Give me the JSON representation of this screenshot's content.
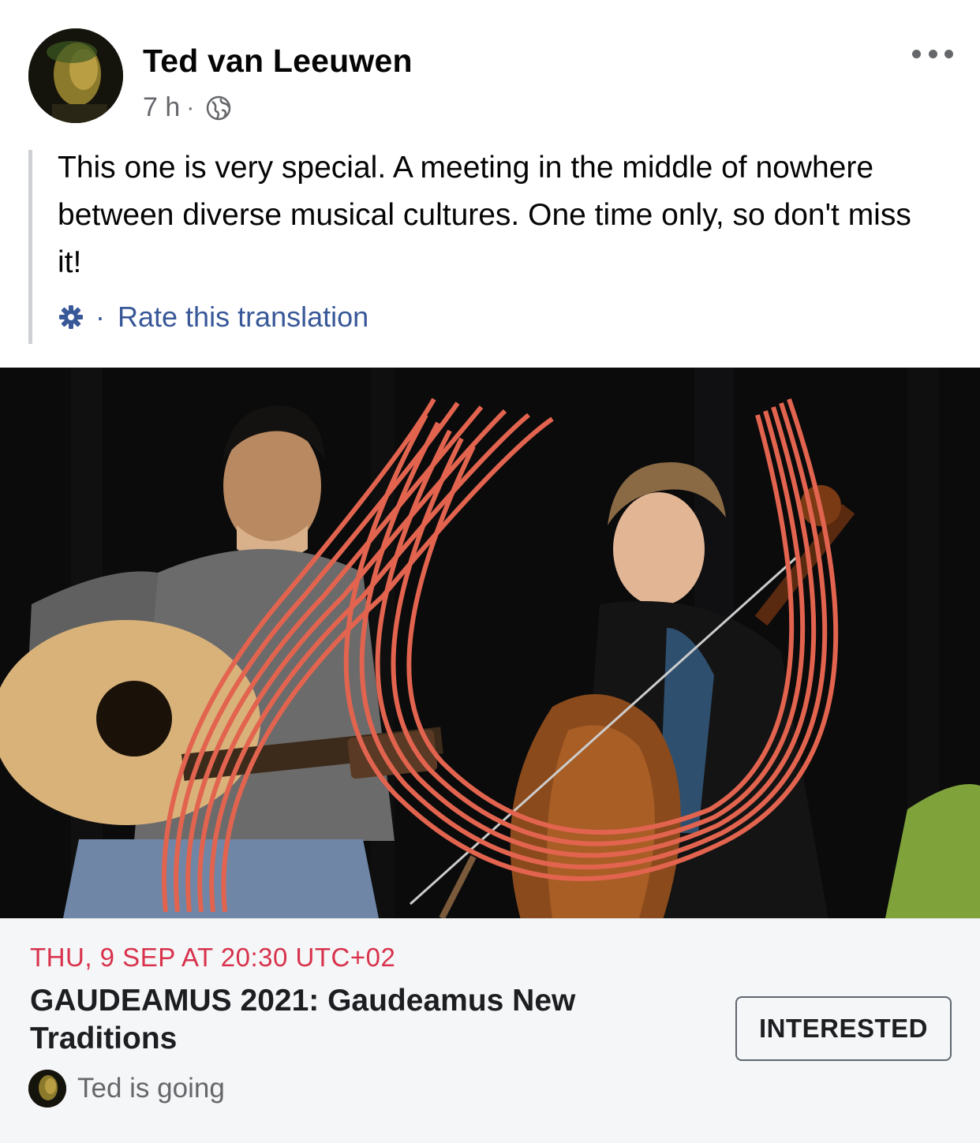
{
  "post": {
    "author": "Ted van Leeuwen",
    "time": "7 h",
    "separator": "·",
    "audience_icon": "globe-icon",
    "menu_icon": "more-horizontal-icon",
    "text": "This one is very special. A meeting in the middle of nowhere between diverse musical cultures. One time only, so don't miss it!",
    "translation": {
      "settings_icon": "gear-icon",
      "separator": "·",
      "rate_label": "Rate this translation"
    }
  },
  "event": {
    "date": "THU, 9 SEP AT 20:30 UTC+02",
    "title": "GAUDEAMUS 2021: Gaudeamus New Traditions",
    "interested_label": "INTERESTED",
    "going_text": "Ted is going"
  },
  "colors": {
    "link": "#385898",
    "date": "#d8324c",
    "secondary_text": "#65676b",
    "card_background": "#f5f6f7",
    "accent_lines": "#e2644f"
  }
}
